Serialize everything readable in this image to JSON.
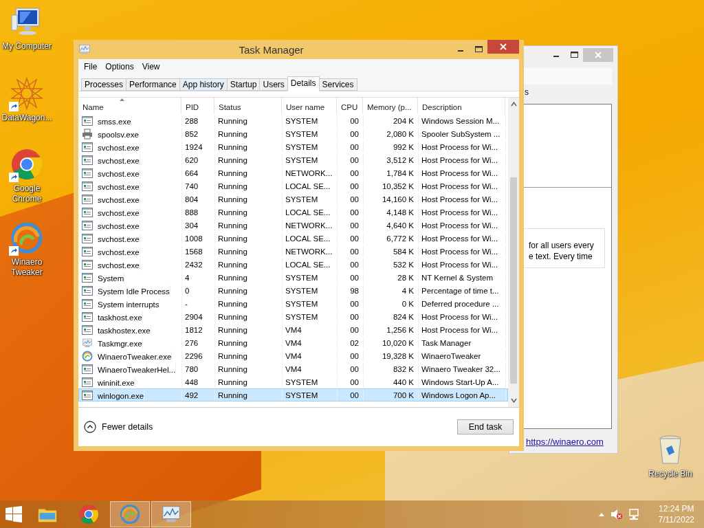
{
  "desktop_icons": [
    {
      "label": "My Computer",
      "kind": "computer",
      "shortcut": false
    },
    {
      "label": "DataWagon...",
      "kind": "star",
      "shortcut": true
    },
    {
      "label": "Google Chrome",
      "kind": "chrome",
      "shortcut": true
    },
    {
      "label": "Winaero Tweaker",
      "kind": "swirl",
      "shortcut": true
    },
    {
      "label": "Recycle Bin",
      "kind": "bin",
      "shortcut": false
    }
  ],
  "background_window": {
    "tab_fragment": "s",
    "lines": [
      "for all users every",
      "e text. Every time"
    ],
    "link": "https://winaero.com"
  },
  "task_manager": {
    "title": "Task Manager",
    "menu": [
      "File",
      "Options",
      "View"
    ],
    "tabs": [
      {
        "label": "Processes",
        "selected": false
      },
      {
        "label": "Performance",
        "selected": false
      },
      {
        "label": "App history",
        "selected": false
      },
      {
        "label": "Startup",
        "selected": false
      },
      {
        "label": "Users",
        "selected": false
      },
      {
        "label": "Details",
        "selected": true
      },
      {
        "label": "Services",
        "selected": false
      }
    ],
    "columns": [
      "Name",
      "PID",
      "Status",
      "User name",
      "CPU",
      "Memory (p...",
      "Description"
    ],
    "rows": [
      {
        "kind": "exe",
        "name": "smss.exe",
        "pid": "288",
        "status": "Running",
        "user": "SYSTEM",
        "cpu": "00",
        "memory": "204 K",
        "description": "Windows Session M...",
        "selected": false
      },
      {
        "kind": "printer",
        "name": "spoolsv.exe",
        "pid": "852",
        "status": "Running",
        "user": "SYSTEM",
        "cpu": "00",
        "memory": "2,080 K",
        "description": "Spooler SubSystem ...",
        "selected": false
      },
      {
        "kind": "exe",
        "name": "svchost.exe",
        "pid": "1924",
        "status": "Running",
        "user": "SYSTEM",
        "cpu": "00",
        "memory": "992 K",
        "description": "Host Process for Wi...",
        "selected": false
      },
      {
        "kind": "exe",
        "name": "svchost.exe",
        "pid": "620",
        "status": "Running",
        "user": "SYSTEM",
        "cpu": "00",
        "memory": "3,512 K",
        "description": "Host Process for Wi...",
        "selected": false
      },
      {
        "kind": "exe",
        "name": "svchost.exe",
        "pid": "664",
        "status": "Running",
        "user": "NETWORK...",
        "cpu": "00",
        "memory": "1,784 K",
        "description": "Host Process for Wi...",
        "selected": false
      },
      {
        "kind": "exe",
        "name": "svchost.exe",
        "pid": "740",
        "status": "Running",
        "user": "LOCAL SE...",
        "cpu": "00",
        "memory": "10,352 K",
        "description": "Host Process for Wi...",
        "selected": false
      },
      {
        "kind": "exe",
        "name": "svchost.exe",
        "pid": "804",
        "status": "Running",
        "user": "SYSTEM",
        "cpu": "00",
        "memory": "14,160 K",
        "description": "Host Process for Wi...",
        "selected": false
      },
      {
        "kind": "exe",
        "name": "svchost.exe",
        "pid": "888",
        "status": "Running",
        "user": "LOCAL SE...",
        "cpu": "00",
        "memory": "4,148 K",
        "description": "Host Process for Wi...",
        "selected": false
      },
      {
        "kind": "exe",
        "name": "svchost.exe",
        "pid": "304",
        "status": "Running",
        "user": "NETWORK...",
        "cpu": "00",
        "memory": "4,640 K",
        "description": "Host Process for Wi...",
        "selected": false
      },
      {
        "kind": "exe",
        "name": "svchost.exe",
        "pid": "1008",
        "status": "Running",
        "user": "LOCAL SE...",
        "cpu": "00",
        "memory": "6,772 K",
        "description": "Host Process for Wi...",
        "selected": false
      },
      {
        "kind": "exe",
        "name": "svchost.exe",
        "pid": "1568",
        "status": "Running",
        "user": "NETWORK...",
        "cpu": "00",
        "memory": "584 K",
        "description": "Host Process for Wi...",
        "selected": false
      },
      {
        "kind": "exe",
        "name": "svchost.exe",
        "pid": "2432",
        "status": "Running",
        "user": "LOCAL SE...",
        "cpu": "00",
        "memory": "532 K",
        "description": "Host Process for Wi...",
        "selected": false
      },
      {
        "kind": "exe",
        "name": "System",
        "pid": "4",
        "status": "Running",
        "user": "SYSTEM",
        "cpu": "00",
        "memory": "28 K",
        "description": "NT Kernel & System",
        "selected": false
      },
      {
        "kind": "exe",
        "name": "System Idle Process",
        "pid": "0",
        "status": "Running",
        "user": "SYSTEM",
        "cpu": "98",
        "memory": "4 K",
        "description": "Percentage of time t...",
        "selected": false
      },
      {
        "kind": "exe",
        "name": "System interrupts",
        "pid": "-",
        "status": "Running",
        "user": "SYSTEM",
        "cpu": "00",
        "memory": "0 K",
        "description": "Deferred procedure ...",
        "selected": false
      },
      {
        "kind": "exe",
        "name": "taskhost.exe",
        "pid": "2904",
        "status": "Running",
        "user": "SYSTEM",
        "cpu": "00",
        "memory": "824 K",
        "description": "Host Process for Wi...",
        "selected": false
      },
      {
        "kind": "exe",
        "name": "taskhostex.exe",
        "pid": "1812",
        "status": "Running",
        "user": "VM4",
        "cpu": "00",
        "memory": "1,256 K",
        "description": "Host Process for Wi...",
        "selected": false
      },
      {
        "kind": "taskmgr",
        "name": "Taskmgr.exe",
        "pid": "276",
        "status": "Running",
        "user": "VM4",
        "cpu": "02",
        "memory": "10,020 K",
        "description": "Task Manager",
        "selected": false
      },
      {
        "kind": "swirl",
        "name": "WinaeroTweaker.exe",
        "pid": "2296",
        "status": "Running",
        "user": "VM4",
        "cpu": "00",
        "memory": "19,328 K",
        "description": "WinaeroTweaker",
        "selected": false
      },
      {
        "kind": "exe",
        "name": "WinaeroTweakerHel...",
        "pid": "780",
        "status": "Running",
        "user": "VM4",
        "cpu": "00",
        "memory": "832 K",
        "description": "Winaero Tweaker 32...",
        "selected": false
      },
      {
        "kind": "exe",
        "name": "wininit.exe",
        "pid": "448",
        "status": "Running",
        "user": "SYSTEM",
        "cpu": "00",
        "memory": "440 K",
        "description": "Windows Start-Up A...",
        "selected": false
      },
      {
        "kind": "exe",
        "name": "winlogon.exe",
        "pid": "492",
        "status": "Running",
        "user": "SYSTEM",
        "cpu": "00",
        "memory": "700 K",
        "description": "Windows Logon Ap...",
        "selected": true
      }
    ],
    "fewer_details": "Fewer details",
    "end_task": "End task"
  },
  "taskbar": {
    "apps": [
      {
        "kind": "folder",
        "active": false
      },
      {
        "kind": "chrome",
        "active": false
      },
      {
        "kind": "swirl",
        "active": true
      },
      {
        "kind": "taskmgr",
        "active": true
      }
    ],
    "time": "12:24 PM",
    "date": "7/11/2022"
  }
}
